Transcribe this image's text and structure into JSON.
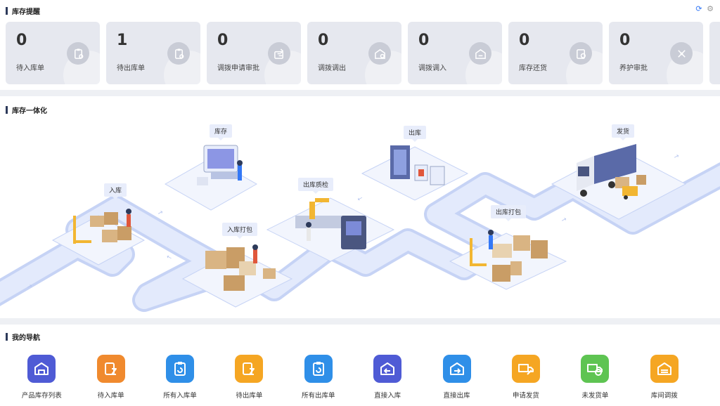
{
  "reminder": {
    "title": "库存提醒",
    "cards": [
      {
        "count": "0",
        "label": "待入库单",
        "icon": "clipboard-gear-icon"
      },
      {
        "count": "1",
        "label": "待出库单",
        "icon": "clipboard-gear-icon"
      },
      {
        "count": "0",
        "label": "调拨申请审批",
        "icon": "transfer-approval-icon"
      },
      {
        "count": "0",
        "label": "调拨调出",
        "icon": "warehouse-out-icon"
      },
      {
        "count": "0",
        "label": "调拨调入",
        "icon": "warehouse-in-icon"
      },
      {
        "count": "0",
        "label": "库存还货",
        "icon": "stock-return-icon"
      },
      {
        "count": "0",
        "label": "养护审批",
        "icon": "maintenance-tools-icon"
      }
    ]
  },
  "integration": {
    "title": "库存一体化",
    "stages": [
      {
        "id": "inbound",
        "label": "入库"
      },
      {
        "id": "stock",
        "label": "库存"
      },
      {
        "id": "inbound_pack",
        "label": "入库打包"
      },
      {
        "id": "outbound_qc",
        "label": "出库质检"
      },
      {
        "id": "outbound",
        "label": "出库"
      },
      {
        "id": "outbound_pack",
        "label": "出库打包"
      },
      {
        "id": "shipping",
        "label": "发货"
      }
    ]
  },
  "navigation": {
    "title": "我的导航",
    "items": [
      {
        "label": "产品库存列表",
        "color": "#4f5bd5",
        "icon": "warehouse-list-icon"
      },
      {
        "label": "待入库单",
        "color": "#f08a2e",
        "icon": "hourglass-doc-icon"
      },
      {
        "label": "所有入库单",
        "color": "#2f8fe8",
        "icon": "clipboard-refresh-icon"
      },
      {
        "label": "待出库单",
        "color": "#f5a623",
        "icon": "hourglass-doc-icon"
      },
      {
        "label": "所有出库单",
        "color": "#2f8fe8",
        "icon": "clipboard-refresh-icon"
      },
      {
        "label": "直接入库",
        "color": "#4f5bd5",
        "icon": "warehouse-arrow-in-icon"
      },
      {
        "label": "直接出库",
        "color": "#2f8fe8",
        "icon": "warehouse-arrow-out-icon"
      },
      {
        "label": "申请发货",
        "color": "#f5a623",
        "icon": "truck-edit-icon"
      },
      {
        "label": "未发货单",
        "color": "#5ec452",
        "icon": "truck-check-icon"
      },
      {
        "label": "库间调拨",
        "color": "#f5a623",
        "icon": "warehouse-transfer-icon"
      }
    ]
  }
}
